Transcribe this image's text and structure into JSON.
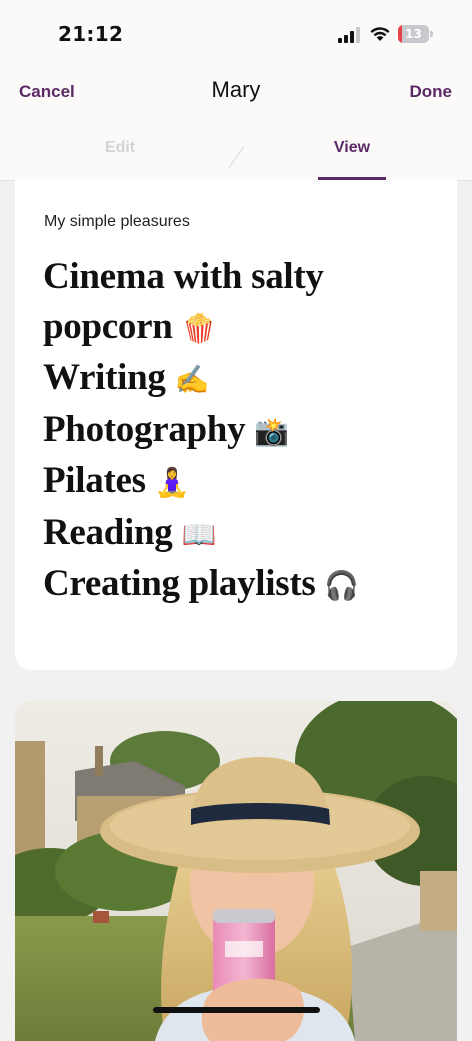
{
  "status_bar": {
    "time": "21:12",
    "battery_level": "13",
    "battery_fraction": 0.13,
    "battery_color": "#e8424a",
    "icons": [
      "signal-icon",
      "wifi-icon",
      "battery-icon"
    ]
  },
  "nav": {
    "cancel_label": "Cancel",
    "title": "Mary",
    "done_label": "Done",
    "tabs": [
      {
        "label": "Edit",
        "active": false
      },
      {
        "label": "View",
        "active": true
      }
    ],
    "accent_color": "#5b2a66"
  },
  "card": {
    "label": "My simple pleasures",
    "items": [
      {
        "text": "Cinema with salty popcorn",
        "emoji": "🍿"
      },
      {
        "text": "Writing",
        "emoji": "✍️"
      },
      {
        "text": "Photography",
        "emoji": "📸"
      },
      {
        "text": "Pilates",
        "emoji": "🧘‍♀️"
      },
      {
        "text": "Reading",
        "emoji": "📖"
      },
      {
        "text": "Creating playlists",
        "emoji": "🎧"
      }
    ]
  },
  "photo": {
    "subject": "photo-woman-straw-hat"
  }
}
